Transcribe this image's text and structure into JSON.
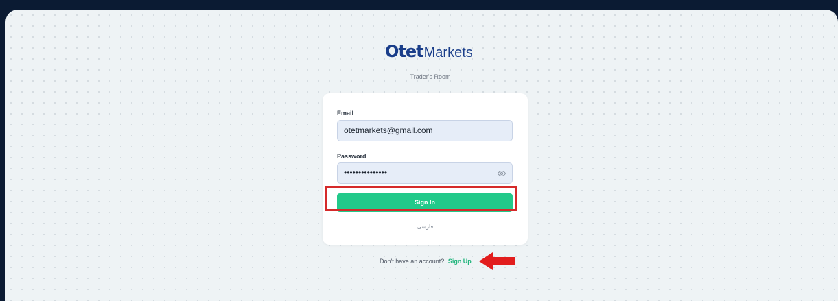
{
  "brand": {
    "mark": "Otet",
    "name": "Markets"
  },
  "subtitle": "Trader's Room",
  "form": {
    "email_label": "Email",
    "email_value": "otetmarkets@gmail.com",
    "password_label": "Password",
    "password_value": "•••••••••••••••",
    "signin_label": "Sign In",
    "language_link": "فارسی"
  },
  "footer": {
    "prompt": "Don't have an account?",
    "signup_label": "Sign Up"
  },
  "icons": {
    "password_toggle": "eye-icon",
    "annotation": "arrow-left-icon"
  },
  "colors": {
    "accent": "#22c98a",
    "brand": "#1a3e8a",
    "highlight": "#d52a2a"
  }
}
